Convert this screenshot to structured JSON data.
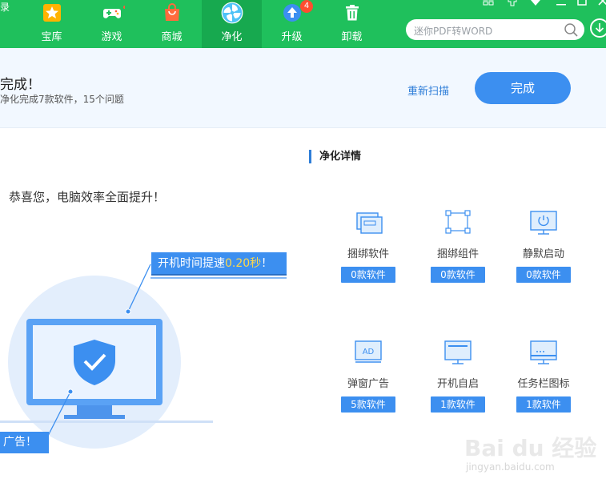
{
  "topbar": {
    "left_cut_text": "录",
    "nav": [
      {
        "label": "宝库",
        "icon": "star-icon"
      },
      {
        "label": "游戏",
        "icon": "gamepad-icon"
      },
      {
        "label": "商城",
        "icon": "shopping-bag-icon"
      },
      {
        "label": "净化",
        "icon": "fan-icon"
      },
      {
        "label": "升级",
        "icon": "upgrade-arrow-icon",
        "badge": "4"
      },
      {
        "label": "卸载",
        "icon": "trash-icon"
      }
    ],
    "search_placeholder": "迷你PDF转WORD",
    "colors": {
      "bar": "#1fc05c",
      "active": "#17a94f"
    }
  },
  "header": {
    "title": "完成！",
    "subtitle": "净化完成7款软件，15个问题",
    "rescan": "重新扫描",
    "done": "完成"
  },
  "main": {
    "congrats": "恭喜您，电脑效率全面提升！",
    "bubble_prefix": "开机时间提速",
    "bubble_value": "0.20秒",
    "bubble_suffix": "！",
    "bubble2": "广告！"
  },
  "details": {
    "title": "净化详情",
    "items": [
      {
        "name": "捆绑软件",
        "count": "0款软件",
        "icon": "bundled-software-icon"
      },
      {
        "name": "捆绑组件",
        "count": "0款软件",
        "icon": "bundled-component-icon"
      },
      {
        "name": "静默启动",
        "count": "0款软件",
        "icon": "silent-start-icon"
      },
      {
        "name": "弹窗广告",
        "count": "5款软件",
        "icon": "ad-popup-icon"
      },
      {
        "name": "开机自启",
        "count": "1款软件",
        "icon": "boot-start-icon"
      },
      {
        "name": "任务栏图标",
        "count": "1款软件",
        "icon": "taskbar-icon"
      }
    ],
    "ad_icon_text": "AD"
  },
  "watermark": {
    "brand": "Bai du 经验",
    "url": "jingyan.baidu.com"
  }
}
